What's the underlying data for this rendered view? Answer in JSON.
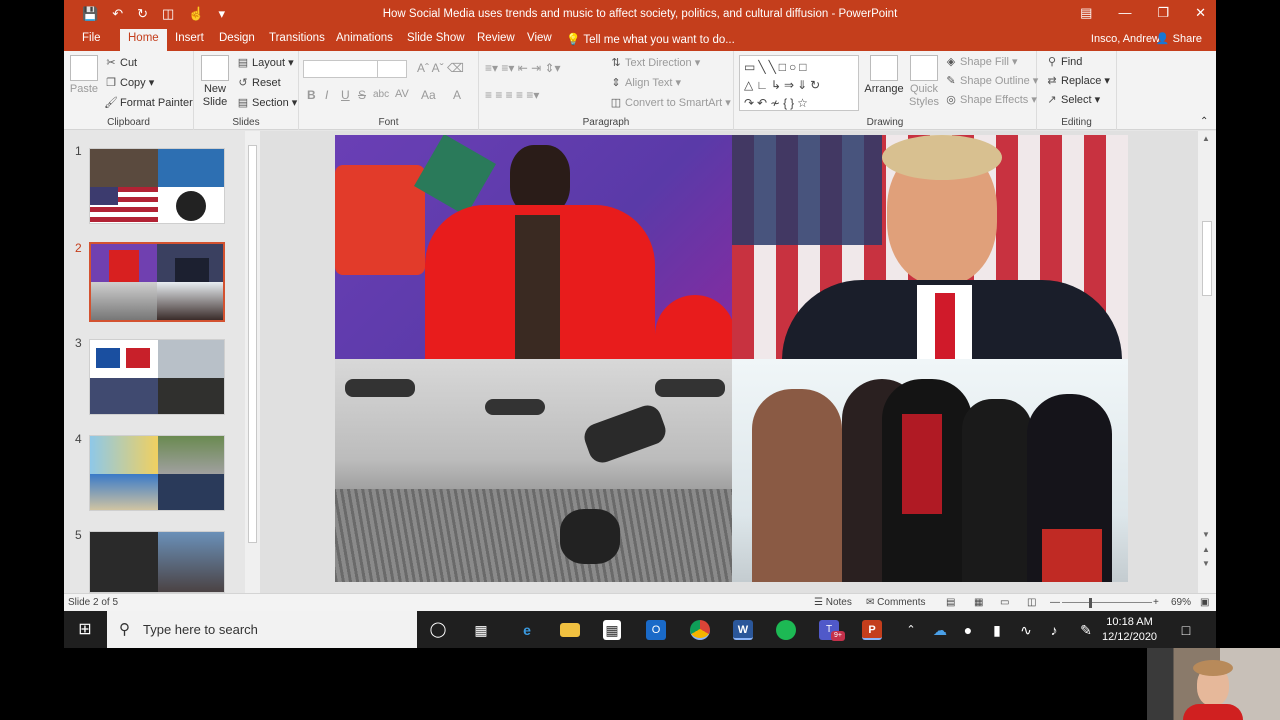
{
  "window": {
    "title": "How Social Media uses trends and music to affect society, politics, and cultural diffusion - PowerPoint",
    "qat_icons": [
      "save-icon",
      "undo-icon",
      "redo-icon",
      "present-icon",
      "touch-mode-icon",
      "customize-icon"
    ]
  },
  "tabs": [
    "File",
    "Home",
    "Insert",
    "Design",
    "Transitions",
    "Animations",
    "Slide Show",
    "Review",
    "View"
  ],
  "tell_me": "Tell me what you want to do...",
  "user": "Insco, Andrew",
  "share": "Share",
  "ribbon": {
    "clipboard": {
      "paste": "Paste",
      "cut": "Cut",
      "copy": "Copy",
      "format_painter": "Format Painter",
      "label": "Clipboard"
    },
    "slides": {
      "new_slide": "New Slide",
      "layout": "Layout",
      "reset": "Reset",
      "section": "Section",
      "label": "Slides"
    },
    "font": {
      "label": "Font",
      "bold": "B",
      "italic": "I",
      "underline": "U",
      "strike": "S",
      "shadow": "abc",
      "spacing": "AV",
      "case": "Aa",
      "color": "A"
    },
    "paragraph": {
      "text_direction": "Text Direction",
      "align_text": "Align Text",
      "convert_smartart": "Convert to SmartArt",
      "label": "Paragraph"
    },
    "drawing": {
      "arrange": "Arrange",
      "quick_styles": "Quick Styles",
      "shape_fill": "Shape Fill",
      "shape_outline": "Shape Outline",
      "shape_effects": "Shape Effects",
      "label": "Drawing"
    },
    "editing": {
      "find": "Find",
      "replace": "Replace",
      "select": "Select",
      "label": "Editing"
    }
  },
  "thumbnails": [
    {
      "number": "1"
    },
    {
      "number": "2"
    },
    {
      "number": "3"
    },
    {
      "number": "4"
    },
    {
      "number": "5"
    }
  ],
  "status": {
    "slide_info": "Slide 2 of 5",
    "notes": "Notes",
    "comments": "Comments",
    "zoom": "69%"
  },
  "taskbar": {
    "search_placeholder": "Type here to search",
    "time": "10:18 AM",
    "date": "12/12/2020",
    "app_icons": [
      "task-view-icon",
      "edge-icon",
      "file-explorer-icon",
      "store-icon",
      "outlook-icon",
      "chrome-icon",
      "word-icon",
      "spotify-icon",
      "teams-icon",
      "powerpoint-icon"
    ],
    "teams_badge": "9+"
  },
  "colors": {
    "accent": "#c43e1c",
    "taskbar": "#1f1f1f"
  }
}
